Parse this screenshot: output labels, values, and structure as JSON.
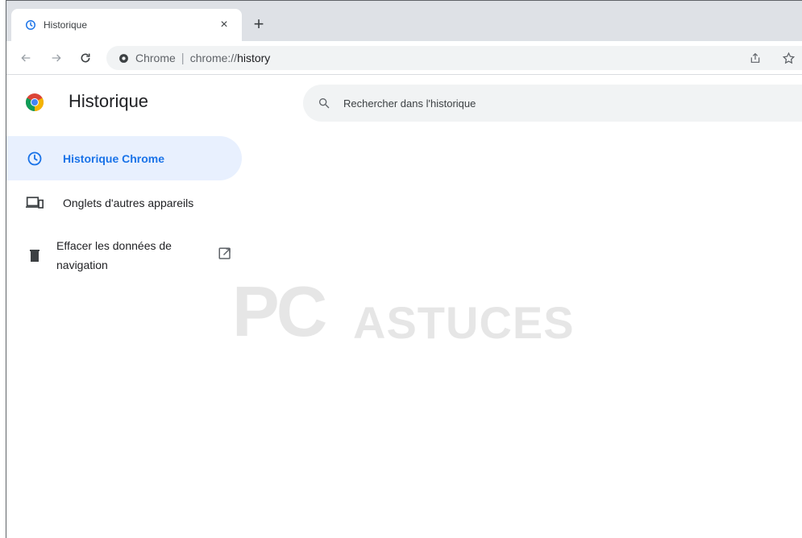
{
  "tab": {
    "title": "Historique",
    "close": "×"
  },
  "new_tab": "+",
  "omnibox": {
    "site_name": "Chrome",
    "separator": "|",
    "url_prefix": "chrome://",
    "url_host": "history"
  },
  "page": {
    "title": "Historique",
    "search_placeholder": "Rechercher dans l'historique",
    "nav": [
      {
        "label": "Historique Chrome",
        "icon": "clock-icon",
        "active": true
      },
      {
        "label": "Onglets d'autres appareils",
        "icon": "devices-icon",
        "active": false
      },
      {
        "label": "Effacer les données de navigation",
        "icon": "trash-icon",
        "active": false
      }
    ]
  },
  "watermark": {
    "pc": "PC",
    "astuces": "ASTUCES"
  },
  "colors": {
    "accent": "#1a73e8",
    "active_bg": "#e8f0fe",
    "tabstrip": "#dee1e6"
  }
}
